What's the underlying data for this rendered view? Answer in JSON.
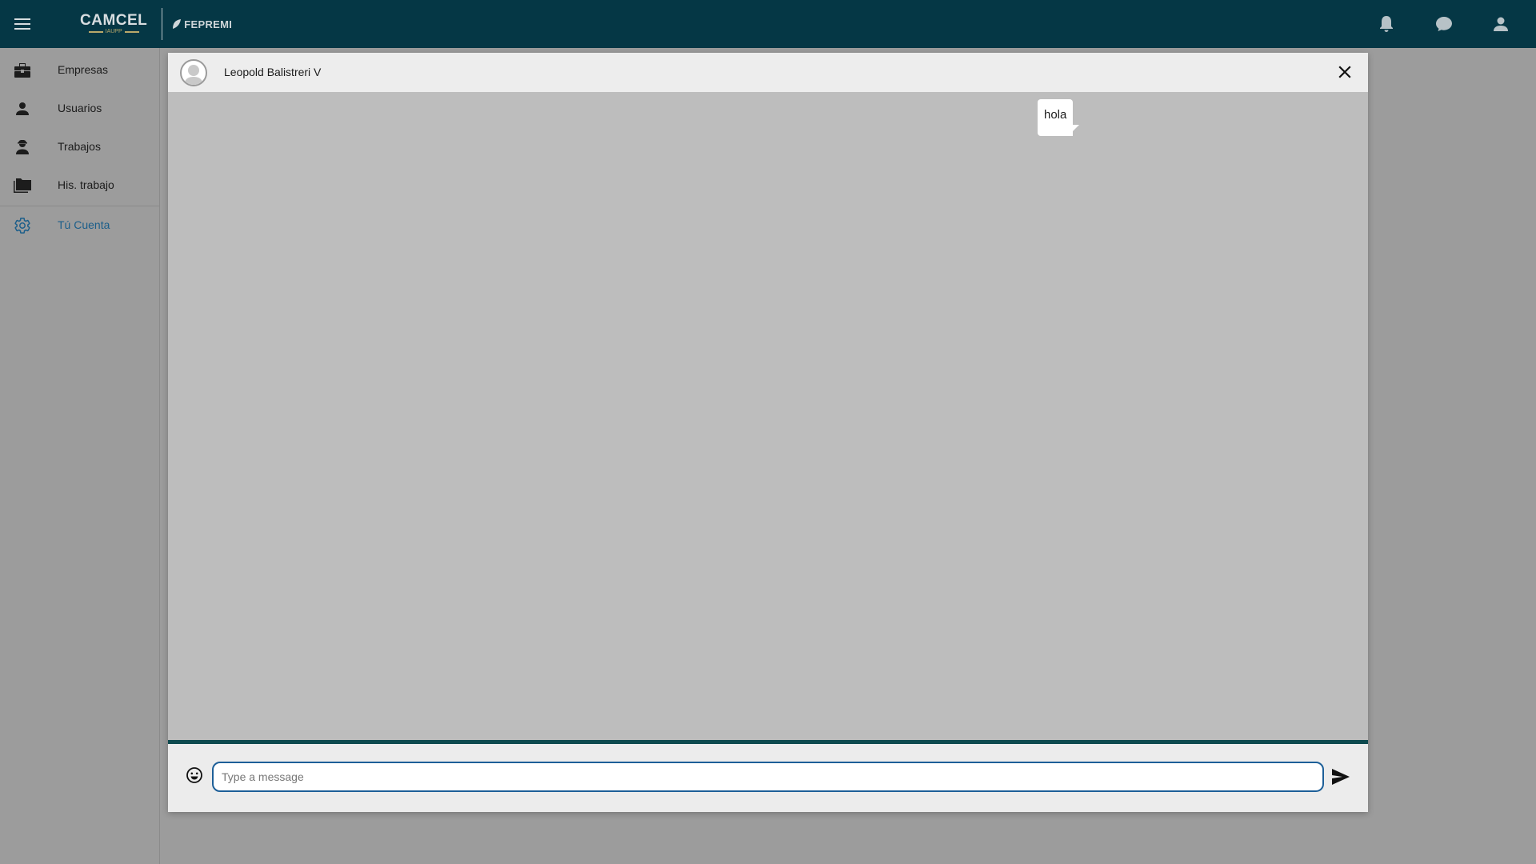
{
  "topbar": {
    "logo_camcel": "CAMCEL",
    "logo_camcel_sub": "IAUPP",
    "logo_fepremi": "FEPREMI",
    "bg_color": "#053745"
  },
  "sidebar": {
    "items": [
      {
        "label": "Empresas",
        "icon": "briefcase-icon"
      },
      {
        "label": "Usuarios",
        "icon": "person-icon"
      },
      {
        "label": "Trabajos",
        "icon": "worker-icon"
      },
      {
        "label": "His. trabajo",
        "icon": "folders-icon"
      },
      {
        "label": "Tú Cuenta",
        "icon": "gear-icon",
        "active": true
      }
    ],
    "active_color": "#1b5e8a"
  },
  "chat": {
    "contact_name": "Leopold Balistreri V",
    "messages": [
      {
        "text": "hola",
        "from": "other"
      }
    ],
    "input_placeholder": "Type a message",
    "input_value": ""
  }
}
